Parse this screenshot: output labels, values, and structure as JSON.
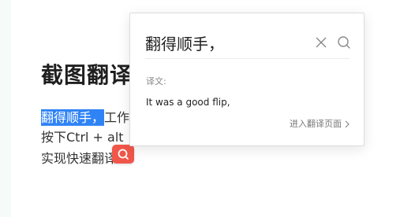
{
  "document": {
    "title": "截图翻译",
    "highlighted_text": "翻得顺手，",
    "line1_rest": "工作",
    "line2": "按下Ctrl + alt",
    "line3": "实现快速翻译"
  },
  "popup": {
    "source_text": "翻得顺手，",
    "close_icon": "close-icon",
    "search_icon": "search-icon",
    "result_label": "译文:",
    "result_text": "It was a good flip,",
    "more_link": "进入翻译页面"
  },
  "float_button": {
    "icon": "search-icon",
    "color": "#f0574a"
  },
  "colors": {
    "selection": "#2f83f5",
    "accent": "#f0574a"
  }
}
